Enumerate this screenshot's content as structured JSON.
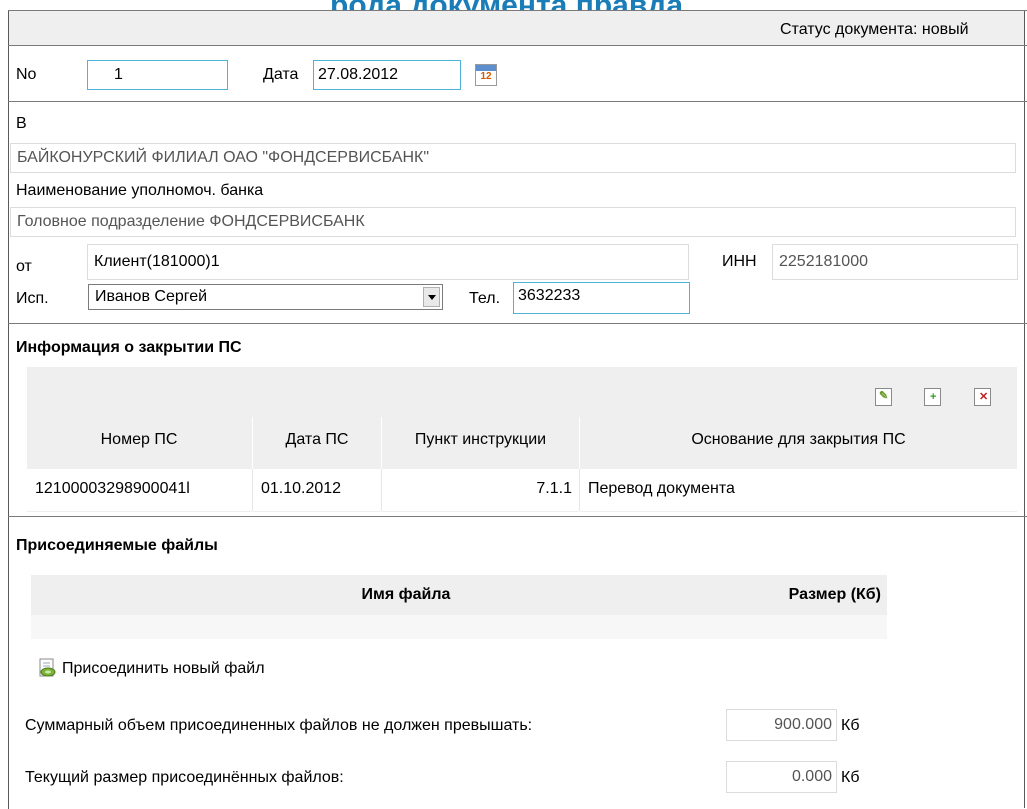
{
  "page_title_partial": "рода документа правда",
  "status": {
    "label": "Статус документа: новый"
  },
  "doc": {
    "no_label": "No",
    "no_value": "1",
    "date_label": "Дата",
    "date_value": "27.08.2012",
    "calendar_icon": "calendar-icon",
    "calendar_text": "12"
  },
  "parties": {
    "to_label": "В",
    "to_value": "БАЙКОНУРСКИЙ ФИЛИАЛ ОАО \"ФОНДСЕРВИСБАНК\"",
    "bank_label": "Наименование уполномоч. банка",
    "bank_value": "Головное подразделение ФОНДСЕРВИСБАНК",
    "from_label": "от",
    "from_value": "Клиент(181000)1",
    "inn_label": "ИНН",
    "inn_value": "2252181000",
    "exec_label": "Исп.",
    "exec_value": "Иванов Сергей",
    "phone_label": "Тел.",
    "phone_value": "3632233"
  },
  "closure": {
    "section_title": "Информация о закрытии ПС",
    "toolbar_icons": [
      "edit-icon",
      "add-icon",
      "delete-icon"
    ],
    "columns": [
      "Номер ПС",
      "Дата ПС",
      "Пункт инструкции",
      "Основание для закрытия ПС"
    ],
    "rows": [
      {
        "number": "12100003298900041l",
        "date": "01.10.2012",
        "item": "7.1.1",
        "reason": "Перевод документа"
      }
    ]
  },
  "files": {
    "section_title": "Присоединяемые файлы",
    "columns": [
      "Имя файла",
      "Размер (Кб)"
    ],
    "attach_label": "Присоединить новый файл",
    "attach_icon": "attach-file-icon",
    "max_label": "Суммарный объем присоединенных файлов не должен превышать:",
    "max_value": "900.000",
    "max_unit": "Кб",
    "current_label": "Текущий размер присоединённых файлов:",
    "current_value": "0.000",
    "current_unit": "Кб"
  },
  "colors": {
    "title_blue": "#1a7db8",
    "field_border_blue": "#4fb3d9",
    "panel_gray": "#efefef"
  }
}
